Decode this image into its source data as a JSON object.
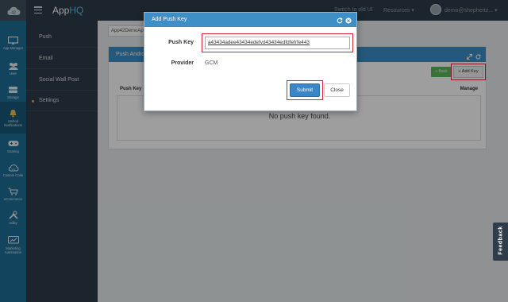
{
  "topbar": {
    "brand_prefix": "App",
    "brand_suffix": "HQ",
    "switch_ui": "Switch to old UI",
    "resources": "Resources",
    "user_email": "demo@shephertz..."
  },
  "rail": {
    "items": [
      {
        "label": "App Manager",
        "icon": "monitor-icon"
      },
      {
        "label": "User",
        "icon": "users-icon"
      },
      {
        "label": "Storage",
        "icon": "storage-icon"
      },
      {
        "label": "Unified Notifications",
        "icon": "bell-icon"
      },
      {
        "label": "Gaming",
        "icon": "gamepad-icon"
      },
      {
        "label": "Custom Code",
        "icon": "cloud-code-icon"
      },
      {
        "label": "eCommerce",
        "icon": "cart-icon"
      },
      {
        "label": "Utility",
        "icon": "tools-icon"
      },
      {
        "label": "Marketing Automation",
        "icon": "marketing-icon"
      }
    ]
  },
  "subnav": {
    "items": [
      "Push",
      "Email",
      "Social Wall Post",
      "Settings"
    ]
  },
  "main": {
    "app_select": "App42DemoAp",
    "panel_title": "Push Andro",
    "back_label": "« Back",
    "add_key_label": "+ Add Key",
    "col_push_key": "Push Key",
    "col_manage": "Manage",
    "empty_message": "No push key found."
  },
  "modal": {
    "title": "Add Push Key",
    "push_key_label": "Push Key",
    "push_key_value": "a43434adee43434edefvd43434edfdfefrfe443",
    "provider_label": "Provider",
    "provider_value": "GCM",
    "submit_label": "Submit",
    "close_label": "Close"
  },
  "feedback": {
    "label": "Feedback"
  },
  "colors": {
    "rail": "#1f6f97",
    "header": "#2e3d49",
    "panel_head": "#3d8fc6",
    "highlight": "#d9233b",
    "submit": "#3a87c8"
  }
}
